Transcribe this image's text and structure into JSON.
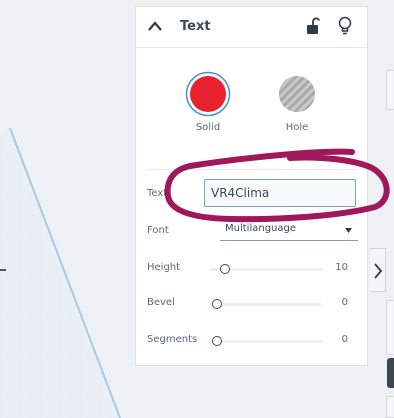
{
  "panel": {
    "title": "Text",
    "solid_label": "Solid",
    "hole_label": "Hole",
    "solid_color": "#e8212f",
    "hole_color": "#b8b8b8"
  },
  "fields": {
    "text_label": "Text",
    "text_value": "VR4Clima",
    "font_label": "Font",
    "font_value": "Multilanguage",
    "height_label": "Height",
    "height_value": "10",
    "bevel_label": "Bevel",
    "bevel_value": "0",
    "segments_label": "Segments",
    "segments_value": "0"
  },
  "annotation_color": "#a0175a",
  "icons": {
    "collapse": "chevron-up-icon",
    "lock": "unlock-icon",
    "bulb": "lightbulb-icon",
    "expand": "chevron-right-icon",
    "dropdown": "caret-down-icon"
  }
}
